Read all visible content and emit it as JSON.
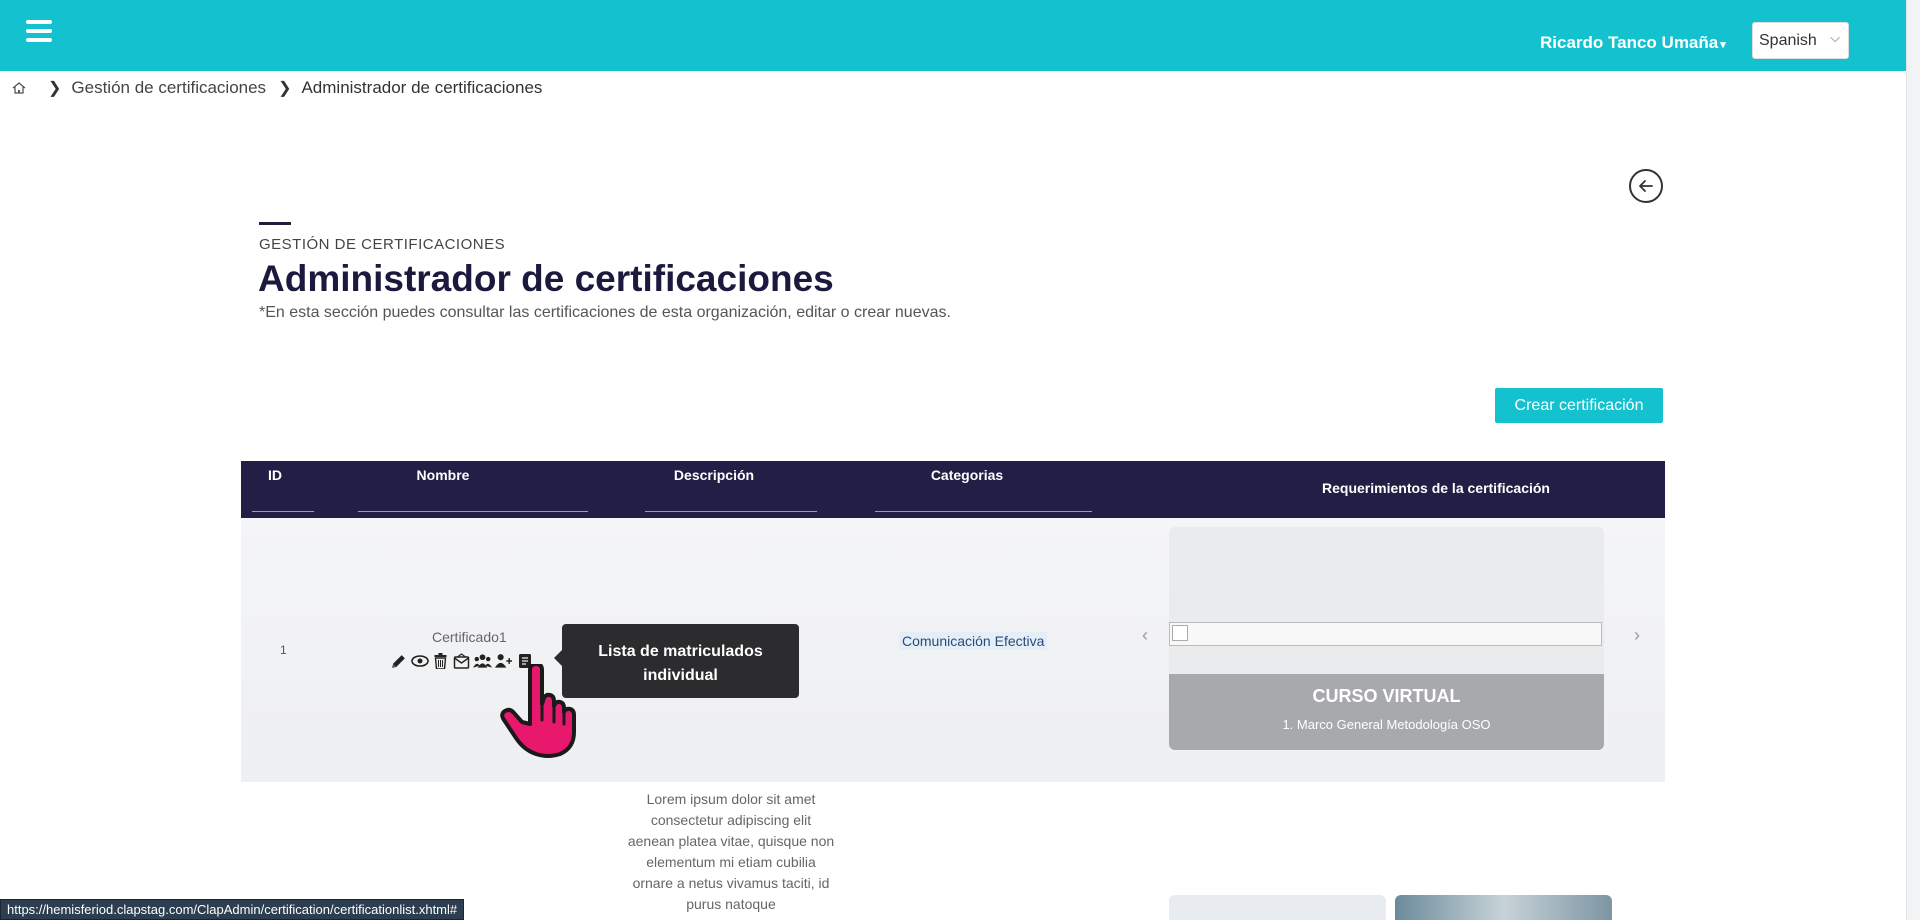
{
  "header": {
    "user_name": "Ricardo Tanco Umaña",
    "language": "Spanish"
  },
  "breadcrumb": {
    "items": [
      "Gestión de certificaciones",
      "Administrador de certificaciones"
    ]
  },
  "page": {
    "eyebrow": "GESTIÓN DE CERTIFICACIONES",
    "title": "Administrador de certificaciones",
    "subtitle": "*En esta sección puedes consultar las certificaciones de esta organización, editar o crear nuevas.",
    "create_button": "Crear certificación"
  },
  "table": {
    "columns": [
      "ID",
      "Nombre",
      "Descripción",
      "Categorias",
      "Requerimientos de la certificación"
    ],
    "rows": [
      {
        "id": "1",
        "name": "Certificado1",
        "category": "Comunicación Efectiva",
        "description": "Lorem ipsum dolor sit amet consectetur adipiscing elit aenean platea vitae, quisque non elementum mi etiam cubilia ornare a netus vivamus taciti, id purus natoque",
        "requirement": {
          "type": "CURSO VIRTUAL",
          "name": "1. Marco General Metodología OSO"
        }
      }
    ]
  },
  "tooltip": {
    "text": "Lista de matriculados individual"
  },
  "status_bar": {
    "url": "https://hemisferiod.clapstag.com/ClapAdmin/certification/certificationlist.xhtml#"
  },
  "icons": [
    "menu-icon",
    "home-icon",
    "chevron-right-icon",
    "arrow-left-icon",
    "pencil-icon",
    "eye-icon",
    "trash-icon",
    "mail-icon",
    "users-icon",
    "user-plus-icon",
    "list-icon",
    "chevron-left-icon",
    "hand-cursor-icon"
  ],
  "colors": {
    "primary": "#14c2cf",
    "table_header": "#221f46",
    "tooltip": "#2c2c2e",
    "cursor": "#e8196c"
  }
}
